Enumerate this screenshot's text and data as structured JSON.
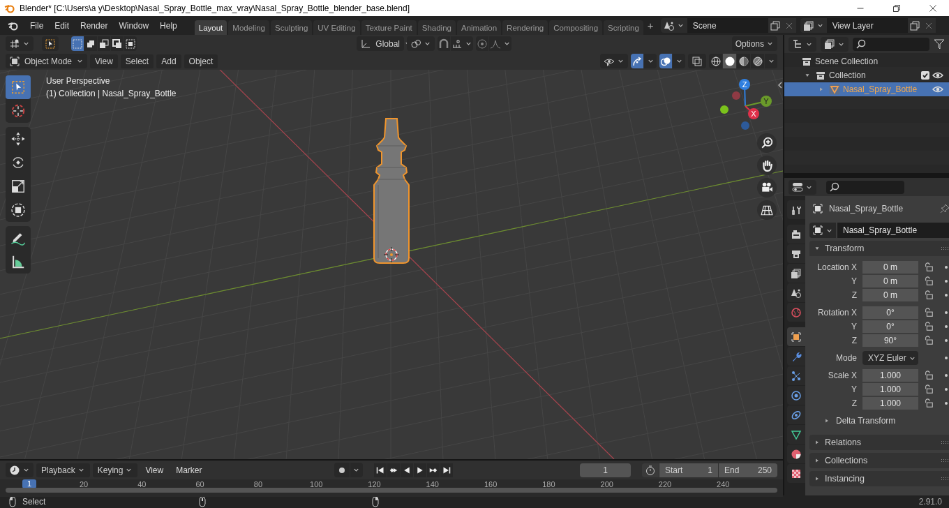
{
  "window": {
    "title": "Blender* [C:\\Users\\a y\\Desktop\\Nasal_Spray_Bottle_max_vray\\Nasal_Spray_Bottle_blender_base.blend]"
  },
  "menu_bar": [
    "File",
    "Edit",
    "Render",
    "Window",
    "Help"
  ],
  "workspace_tabs": [
    {
      "label": "Layout",
      "selected": true
    },
    {
      "label": "Modeling",
      "selected": false
    },
    {
      "label": "Sculpting",
      "selected": false
    },
    {
      "label": "UV Editing",
      "selected": false
    },
    {
      "label": "Texture Paint",
      "selected": false
    },
    {
      "label": "Shading",
      "selected": false
    },
    {
      "label": "Animation",
      "selected": false
    },
    {
      "label": "Rendering",
      "selected": false
    },
    {
      "label": "Compositing",
      "selected": false
    },
    {
      "label": "Scripting",
      "selected": false
    }
  ],
  "add_workspace": "+",
  "scene": {
    "value": "Scene"
  },
  "view_layer": {
    "value": "View Layer"
  },
  "tool_header": {
    "select_modes": [
      {
        "selected": true
      },
      {
        "selected": false
      },
      {
        "selected": false
      },
      {
        "selected": false
      },
      {
        "selected": false
      }
    ],
    "orientation": "Global",
    "options": "Options"
  },
  "viewport_header": {
    "mode": "Object Mode",
    "menus": [
      "View",
      "Select",
      "Add",
      "Object"
    ],
    "show_gizmos": true,
    "show_overlays": true,
    "shading_modes": [
      {
        "kind": "wireframe",
        "selected": false
      },
      {
        "kind": "solid",
        "selected": true
      },
      {
        "kind": "material",
        "selected": false
      },
      {
        "kind": "rendered",
        "selected": false
      }
    ]
  },
  "viewport": {
    "overlay_text": [
      "User Perspective",
      "(1) Collection | Nasal_Spray_Bottle"
    ],
    "tool_groups": [
      [
        {
          "kind": "select_box",
          "selected": true
        },
        {
          "kind": "cursor",
          "selected": false
        }
      ],
      [
        {
          "kind": "move",
          "selected": false
        },
        {
          "kind": "rotate",
          "selected": false
        },
        {
          "kind": "scale",
          "selected": false
        },
        {
          "kind": "transform",
          "selected": false
        }
      ],
      [
        {
          "kind": "annotate",
          "selected": false
        },
        {
          "kind": "measure",
          "selected": false
        }
      ]
    ],
    "gizmo_axes": [
      "Z",
      "Y",
      "X"
    ]
  },
  "outliner": {
    "items": [
      {
        "label": "Scene Collection",
        "kind": "scene",
        "selected": false,
        "children": [
          {
            "label": "Collection",
            "kind": "collection",
            "selected": false,
            "expanded": true,
            "checked": true,
            "visible": true,
            "children": [
              {
                "label": "Nasal_Spray_Bottle",
                "kind": "mesh",
                "selected": true,
                "expanded": false,
                "visible": true
              }
            ]
          }
        ]
      }
    ]
  },
  "properties": {
    "tab_groups": [
      [
        {
          "kind": "tool",
          "selected": false
        }
      ],
      [
        {
          "kind": "render",
          "selected": false
        },
        {
          "kind": "output",
          "selected": false
        },
        {
          "kind": "view_layer",
          "selected": false
        },
        {
          "kind": "scene",
          "selected": false
        },
        {
          "kind": "world",
          "selected": false
        }
      ],
      [
        {
          "kind": "object",
          "selected": true
        },
        {
          "kind": "modifiers",
          "selected": false
        },
        {
          "kind": "particles",
          "selected": false
        },
        {
          "kind": "physics",
          "selected": false
        },
        {
          "kind": "constraints",
          "selected": false
        },
        {
          "kind": "data",
          "selected": false
        },
        {
          "kind": "material",
          "selected": false
        },
        {
          "kind": "texture",
          "selected": false
        }
      ]
    ],
    "object_name": "Nasal_Spray_Bottle",
    "data_name": "Nasal_Spray_Bottle",
    "panels": [
      {
        "label": "Transform",
        "expanded": true,
        "groups": [
          [
            {
              "label": "Location X",
              "value": "0 m",
              "kind": "number"
            },
            {
              "label": "Y",
              "value": "0 m",
              "kind": "number"
            },
            {
              "label": "Z",
              "value": "0 m",
              "kind": "number"
            }
          ],
          [
            {
              "label": "Rotation X",
              "value": "0°",
              "kind": "number"
            },
            {
              "label": "Y",
              "value": "0°",
              "kind": "number"
            },
            {
              "label": "Z",
              "value": "90°",
              "kind": "number"
            }
          ],
          [
            {
              "label": "Mode",
              "value": "XYZ Euler",
              "kind": "dropdown"
            }
          ],
          [
            {
              "label": "Scale X",
              "value": "1.000",
              "kind": "number"
            },
            {
              "label": "Y",
              "value": "1.000",
              "kind": "number"
            },
            {
              "label": "Z",
              "value": "1.000",
              "kind": "number"
            }
          ]
        ],
        "subpanels": [
          {
            "label": "Delta Transform",
            "expanded": false
          }
        ]
      },
      {
        "label": "Relations",
        "expanded": false
      },
      {
        "label": "Collections",
        "expanded": false
      },
      {
        "label": "Instancing",
        "expanded": false
      }
    ]
  },
  "timeline": {
    "menus": [
      {
        "label": "Playback",
        "kind": "dropdown"
      },
      {
        "label": "Keying",
        "kind": "dropdown"
      },
      {
        "label": "View",
        "kind": "menu"
      },
      {
        "label": "Marker",
        "kind": "menu"
      }
    ],
    "current_frame": "1",
    "start_label": "Start",
    "start": "1",
    "end_label": "End",
    "end": "250",
    "playhead": "1",
    "ruler": [
      "20",
      "40",
      "60",
      "80",
      "100",
      "120",
      "140",
      "160",
      "180",
      "200",
      "220",
      "240"
    ]
  },
  "status_bar": {
    "hint": "Select",
    "version": "2.91.0"
  }
}
